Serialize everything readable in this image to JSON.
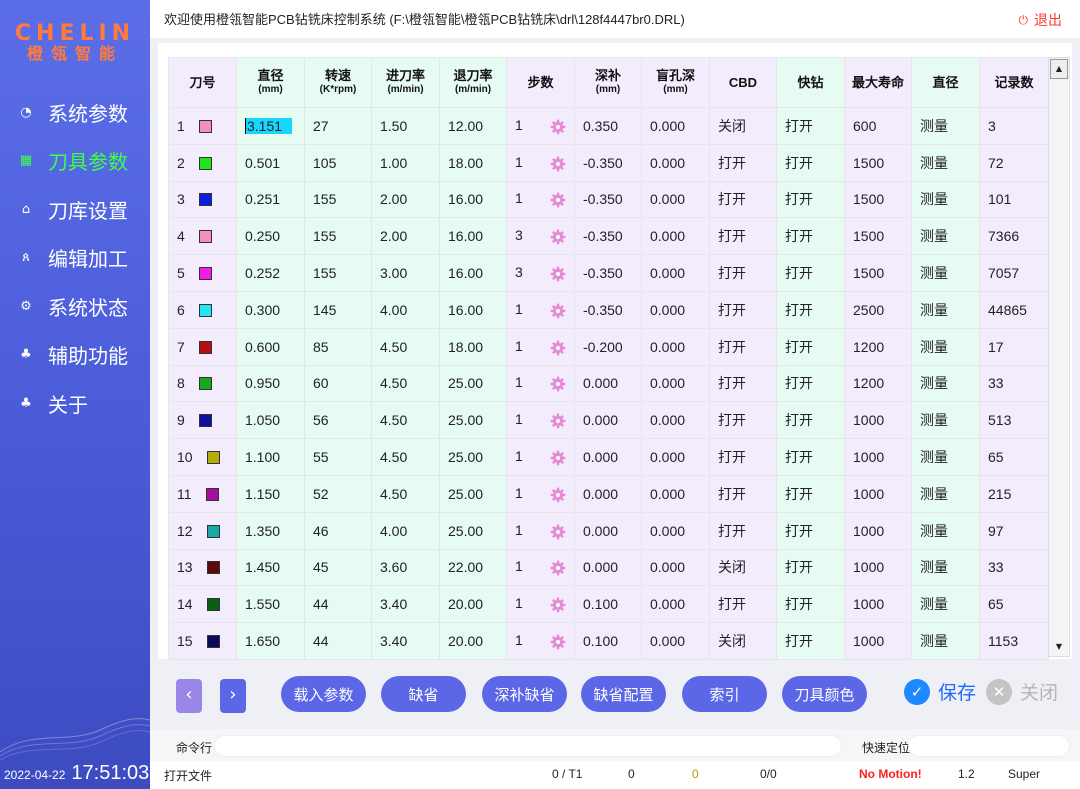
{
  "colors": {
    "accent": "#5b67e6",
    "active_nav": "#3dff4a",
    "logo": "#ff7a3c",
    "danger": "#ff3b30",
    "cell_selected": "#18d7ff"
  },
  "logo": {
    "main": "CHELIN",
    "sub": "橙瓴智能"
  },
  "sidebar": {
    "items": [
      {
        "label": "系统参数",
        "icon": "clock-icon",
        "active": false
      },
      {
        "label": "刀具参数",
        "icon": "grid-icon",
        "active": true
      },
      {
        "label": "刀库设置",
        "icon": "home-icon",
        "active": false
      },
      {
        "label": "编辑加工",
        "icon": "user-icon",
        "active": false
      },
      {
        "label": "系统状态",
        "icon": "gear-icon",
        "active": false
      },
      {
        "label": "辅助功能",
        "icon": "tree-icon",
        "active": false
      },
      {
        "label": "关于",
        "icon": "tree-icon",
        "active": false
      }
    ],
    "date": "2022-04-22",
    "time": "17:51:03"
  },
  "header": {
    "title": "欢迎使用橙瓴智能PCB钻铣床控制系统 (F:\\橙瓴智能\\橙瓴PCB钻铣床\\drl\\128f4447br0.DRL)",
    "logout": "退出"
  },
  "table": {
    "columns": [
      {
        "label": "刀号",
        "unit": ""
      },
      {
        "label": "直径",
        "unit": "(mm)"
      },
      {
        "label": "转速",
        "unit": "(K*rpm)"
      },
      {
        "label": "进刀率",
        "unit": "(m/min)"
      },
      {
        "label": "退刀率",
        "unit": "(m/min)"
      },
      {
        "label": "步数",
        "unit": ""
      },
      {
        "label": "深补",
        "unit": "(mm)"
      },
      {
        "label": "盲孔深",
        "unit": "(mm)"
      },
      {
        "label": "CBD",
        "unit": ""
      },
      {
        "label": "快钻",
        "unit": ""
      },
      {
        "label": "最大寿命",
        "unit": ""
      },
      {
        "label": "直径",
        "unit": ""
      },
      {
        "label": "记录数",
        "unit": ""
      }
    ],
    "rows": [
      {
        "no": "1",
        "color": "#f48fb8",
        "diameter": "3.151",
        "speed": "27",
        "feed": "1.50",
        "retract": "12.00",
        "steps": "1",
        "depth_comp": "0.350",
        "blind": "0.000",
        "cbd": "关闭",
        "fast": "打开",
        "life": "600",
        "measure": "测量",
        "records": "3"
      },
      {
        "no": "2",
        "color": "#22e51e",
        "diameter": "0.501",
        "speed": "105",
        "feed": "1.00",
        "retract": "18.00",
        "steps": "1",
        "depth_comp": "-0.350",
        "blind": "0.000",
        "cbd": "打开",
        "fast": "打开",
        "life": "1500",
        "measure": "测量",
        "records": "72"
      },
      {
        "no": "3",
        "color": "#0b1de0",
        "diameter": "0.251",
        "speed": "155",
        "feed": "2.00",
        "retract": "16.00",
        "steps": "1",
        "depth_comp": "-0.350",
        "blind": "0.000",
        "cbd": "打开",
        "fast": "打开",
        "life": "1500",
        "measure": "测量",
        "records": "101"
      },
      {
        "no": "4",
        "color": "#f48fb8",
        "diameter": "0.250",
        "speed": "155",
        "feed": "2.00",
        "retract": "16.00",
        "steps": "3",
        "depth_comp": "-0.350",
        "blind": "0.000",
        "cbd": "打开",
        "fast": "打开",
        "life": "1500",
        "measure": "测量",
        "records": "7366"
      },
      {
        "no": "5",
        "color": "#f21ce6",
        "diameter": "0.252",
        "speed": "155",
        "feed": "3.00",
        "retract": "16.00",
        "steps": "3",
        "depth_comp": "-0.350",
        "blind": "0.000",
        "cbd": "打开",
        "fast": "打开",
        "life": "1500",
        "measure": "测量",
        "records": "7057"
      },
      {
        "no": "6",
        "color": "#22e8f2",
        "diameter": "0.300",
        "speed": "145",
        "feed": "4.00",
        "retract": "16.00",
        "steps": "1",
        "depth_comp": "-0.350",
        "blind": "0.000",
        "cbd": "打开",
        "fast": "打开",
        "life": "2500",
        "measure": "测量",
        "records": "44865"
      },
      {
        "no": "7",
        "color": "#b40e12",
        "diameter": "0.600",
        "speed": "85",
        "feed": "4.50",
        "retract": "18.00",
        "steps": "1",
        "depth_comp": "-0.200",
        "blind": "0.000",
        "cbd": "打开",
        "fast": "打开",
        "life": "1200",
        "measure": "测量",
        "records": "17"
      },
      {
        "no": "8",
        "color": "#18a81c",
        "diameter": "0.950",
        "speed": "60",
        "feed": "4.50",
        "retract": "25.00",
        "steps": "1",
        "depth_comp": "0.000",
        "blind": "0.000",
        "cbd": "打开",
        "fast": "打开",
        "life": "1200",
        "measure": "测量",
        "records": "33"
      },
      {
        "no": "9",
        "color": "#0c129e",
        "diameter": "1.050",
        "speed": "56",
        "feed": "4.50",
        "retract": "25.00",
        "steps": "1",
        "depth_comp": "0.000",
        "blind": "0.000",
        "cbd": "打开",
        "fast": "打开",
        "life": "1000",
        "measure": "测量",
        "records": "513"
      },
      {
        "no": "10",
        "color": "#b3ad0c",
        "diameter": "1.100",
        "speed": "55",
        "feed": "4.50",
        "retract": "25.00",
        "steps": "1",
        "depth_comp": "0.000",
        "blind": "0.000",
        "cbd": "打开",
        "fast": "打开",
        "life": "1000",
        "measure": "测量",
        "records": "65"
      },
      {
        "no": "11",
        "color": "#a3129e",
        "diameter": "1.150",
        "speed": "52",
        "feed": "4.50",
        "retract": "25.00",
        "steps": "1",
        "depth_comp": "0.000",
        "blind": "0.000",
        "cbd": "打开",
        "fast": "打开",
        "life": "1000",
        "measure": "测量",
        "records": "215"
      },
      {
        "no": "12",
        "color": "#19a8a6",
        "diameter": "1.350",
        "speed": "46",
        "feed": "4.00",
        "retract": "25.00",
        "steps": "1",
        "depth_comp": "0.000",
        "blind": "0.000",
        "cbd": "打开",
        "fast": "打开",
        "life": "1000",
        "measure": "测量",
        "records": "97"
      },
      {
        "no": "13",
        "color": "#5b0a0b",
        "diameter": "1.450",
        "speed": "45",
        "feed": "3.60",
        "retract": "22.00",
        "steps": "1",
        "depth_comp": "0.000",
        "blind": "0.000",
        "cbd": "关闭",
        "fast": "打开",
        "life": "1000",
        "measure": "测量",
        "records": "33"
      },
      {
        "no": "14",
        "color": "#0b5e14",
        "diameter": "1.550",
        "speed": "44",
        "feed": "3.40",
        "retract": "20.00",
        "steps": "1",
        "depth_comp": "0.100",
        "blind": "0.000",
        "cbd": "打开",
        "fast": "打开",
        "life": "1000",
        "measure": "测量",
        "records": "65"
      },
      {
        "no": "15",
        "color": "#0a0c5a",
        "diameter": "1.650",
        "speed": "44",
        "feed": "3.40",
        "retract": "20.00",
        "steps": "1",
        "depth_comp": "0.100",
        "blind": "0.000",
        "cbd": "关闭",
        "fast": "打开",
        "life": "1000",
        "measure": "测量",
        "records": "1153"
      }
    ]
  },
  "buttons": {
    "prev": "‹",
    "next": "›",
    "load": "载入参数",
    "default": "缺省",
    "depth_default": "深补缺省",
    "default_config": "缺省配置",
    "index": "索引",
    "tool_color": "刀具颜色",
    "save": "保存",
    "close": "关闭"
  },
  "command": {
    "label": "命令行",
    "quick_locate": "快速定位"
  },
  "status": {
    "open_file": "打开文件",
    "tool": "0 / T1",
    "v1": "0",
    "v2": "0",
    "v3": "0/0",
    "motion": "No Motion!",
    "version": "1.2",
    "user": "Super"
  }
}
